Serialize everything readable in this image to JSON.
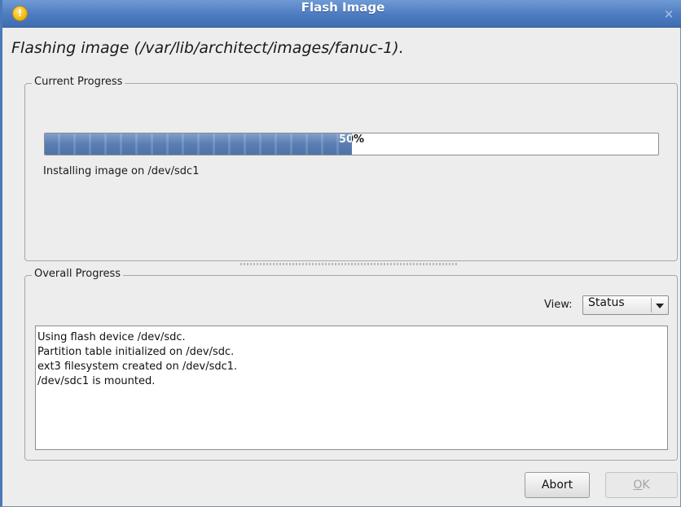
{
  "window": {
    "title": "Flash Image",
    "close_glyph": "×",
    "icon": "warning-icon"
  },
  "heading": "Flashing image (/var/lib/architect/images/fanuc-1).",
  "current": {
    "label": "Current Progress",
    "progress_percent": 50,
    "progress_text": "50%",
    "status": "Installing image on /dev/sdc1"
  },
  "overall": {
    "label": "Overall Progress",
    "view_label": "View:",
    "view_value": "Status",
    "log_lines": [
      "Using flash device /dev/sdc.",
      "Partition table initialized on /dev/sdc.",
      "ext3 filesystem created on /dev/sdc1.",
      "/dev/sdc1 is mounted."
    ]
  },
  "buttons": {
    "abort": "Abort",
    "ok_mnemonic": "O",
    "ok_rest": "K"
  },
  "colors": {
    "titlebar": "#4d7bbf",
    "progress_fill": "#5a7eb3"
  }
}
